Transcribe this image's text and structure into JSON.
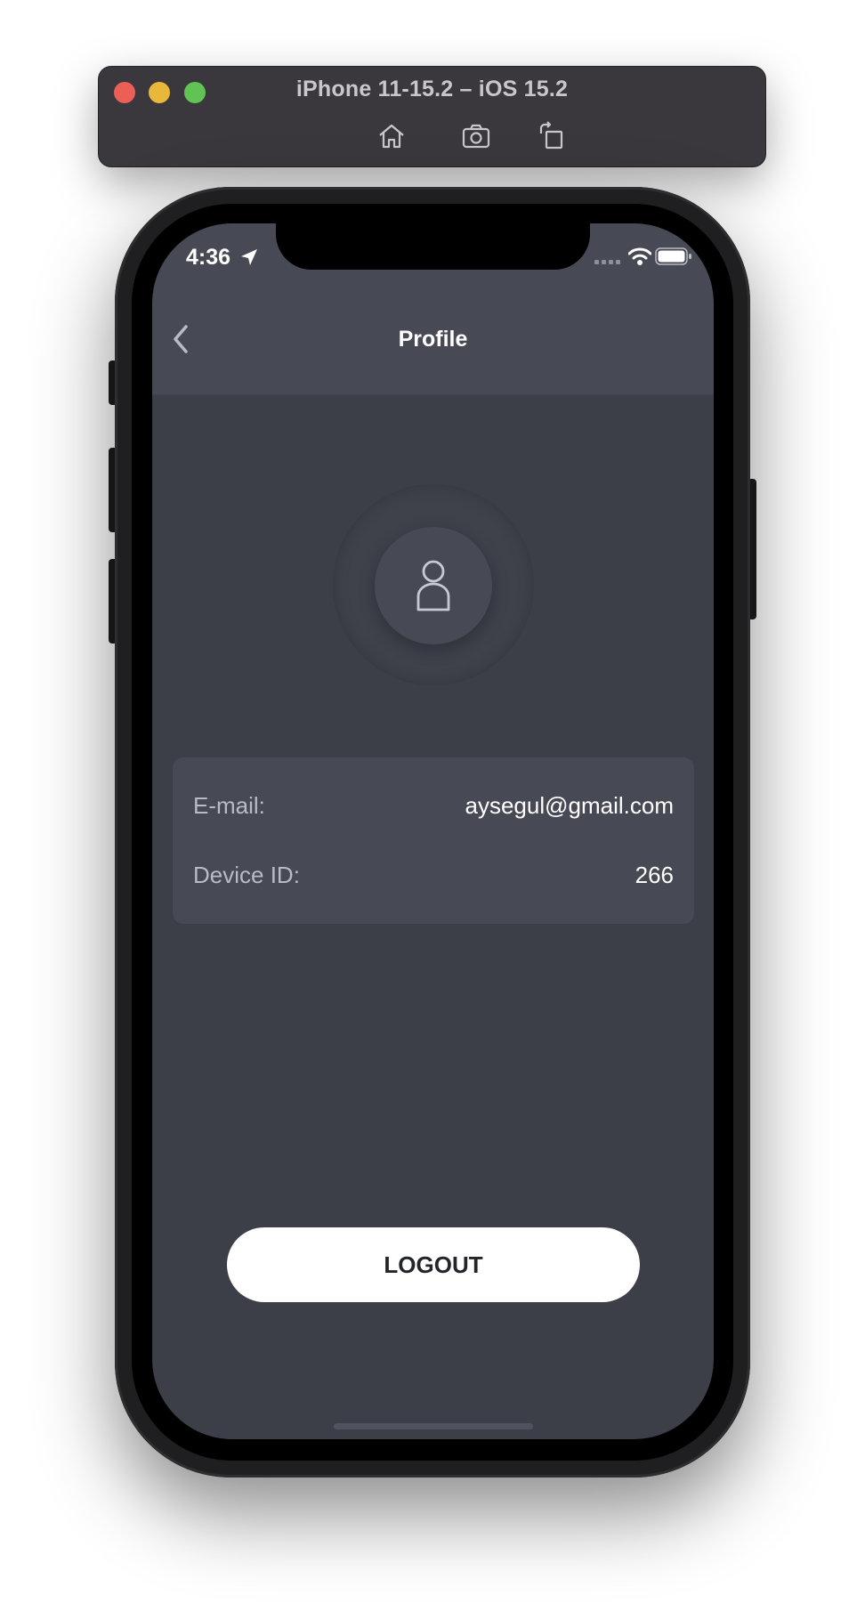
{
  "simulator": {
    "title": "iPhone 11-15.2 – iOS 15.2",
    "toolbar_icons": [
      "home-icon",
      "screenshot-icon",
      "rotate-icon"
    ]
  },
  "status_bar": {
    "time": "4:36",
    "icons": [
      "location-arrow-icon",
      "signal-icon",
      "wifi-icon",
      "battery-icon"
    ]
  },
  "nav": {
    "title": "Profile",
    "back_icon": "chevron-left-icon"
  },
  "avatar": {
    "icon": "user-icon"
  },
  "profile_info": {
    "email_label": "E-mail:",
    "email_value": "aysegul@gmail.com",
    "device_label": "Device ID:",
    "device_value": "266"
  },
  "actions": {
    "logout_label": "LOGOUT"
  },
  "colors": {
    "screen_background": "#3c3e48",
    "nav_background": "#474a55",
    "card_background": "#474a55",
    "button_background": "#ffffff",
    "button_text": "#23252b"
  }
}
